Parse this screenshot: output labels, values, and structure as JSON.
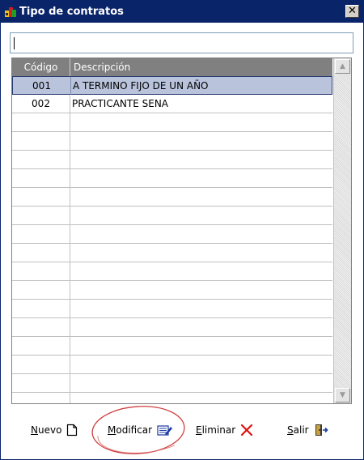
{
  "window": {
    "title": "Tipo de contratos",
    "close_glyph": "✕"
  },
  "search": {
    "value": ""
  },
  "grid": {
    "columns": [
      "Código",
      "Descripción"
    ],
    "rows": [
      {
        "code": "001",
        "description": "A TERMINO FIJO DE UN AÑO",
        "selected": true
      },
      {
        "code": "002",
        "description": "PRACTICANTE SENA",
        "selected": false
      }
    ],
    "empty_rows": 16
  },
  "toolbar": {
    "nuevo": {
      "label_first": "N",
      "label_rest": "uevo",
      "icon": "new-document-icon"
    },
    "modificar": {
      "label_first": "M",
      "label_rest": "odificar",
      "icon": "edit-icon"
    },
    "eliminar": {
      "label_first": "E",
      "label_rest": "liminar",
      "icon": "delete-icon"
    },
    "salir": {
      "label_first": "S",
      "label_rest": "alir",
      "icon": "exit-door-icon"
    }
  },
  "colors": {
    "titlebar": "#0a246a",
    "selected_row": "#b9c4dc",
    "header": "#808080",
    "annotation_circle": "#d04040"
  }
}
